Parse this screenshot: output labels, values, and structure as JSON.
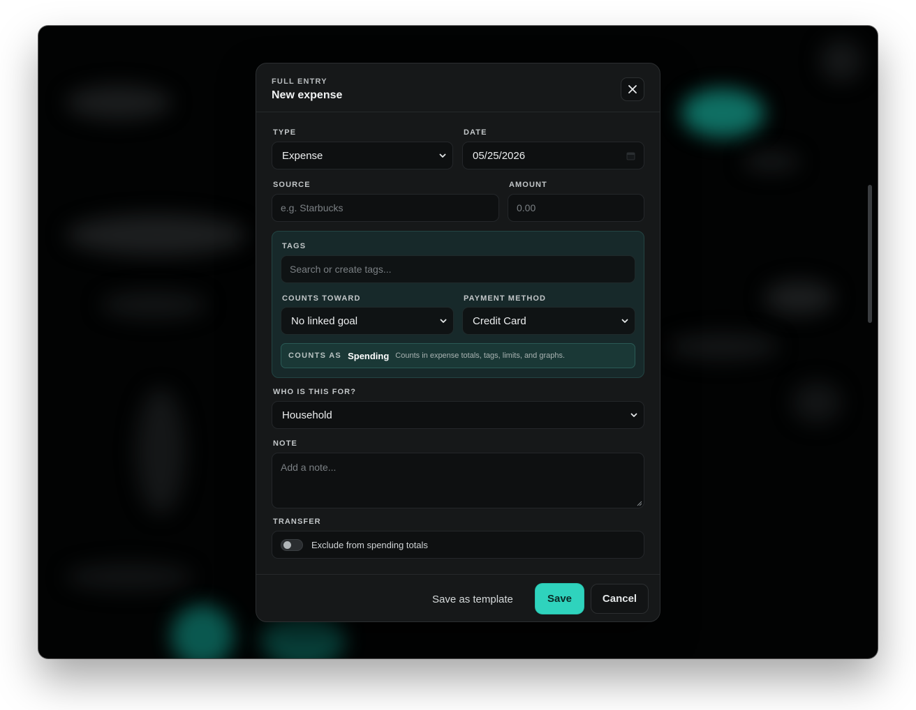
{
  "modal": {
    "eyebrow": "FULL ENTRY",
    "title": "New expense",
    "close_icon": "close-icon"
  },
  "form": {
    "type": {
      "label": "TYPE",
      "value": "Expense"
    },
    "date": {
      "label": "DATE",
      "value": "05/25/2026"
    },
    "source": {
      "label": "SOURCE",
      "placeholder": "e.g. Starbucks"
    },
    "amount": {
      "label": "AMOUNT",
      "placeholder": "0.00"
    },
    "tags": {
      "label": "TAGS",
      "placeholder": "Search or create tags..."
    },
    "counts_toward": {
      "label": "COUNTS TOWARD",
      "value": "No linked goal"
    },
    "payment_method": {
      "label": "PAYMENT METHOD",
      "value": "Credit Card"
    },
    "counts_as": {
      "key": "COUNTS AS",
      "value": "Spending",
      "description": "Counts in expense totals, tags, limits, and graphs."
    },
    "who_for": {
      "label": "WHO IS THIS FOR?",
      "value": "Household"
    },
    "note": {
      "label": "NOTE",
      "placeholder": "Add a note..."
    },
    "transfer": {
      "label": "TRANSFER",
      "toggle_text": "Exclude from spending totals",
      "enabled": false
    }
  },
  "footer": {
    "save_template_label": "Save as template",
    "save_label": "Save",
    "cancel_label": "Cancel"
  },
  "colors": {
    "accent": "#2fd3bd",
    "panel_bg": "#17292a",
    "modal_bg": "#161819",
    "backdrop": "#020303"
  }
}
